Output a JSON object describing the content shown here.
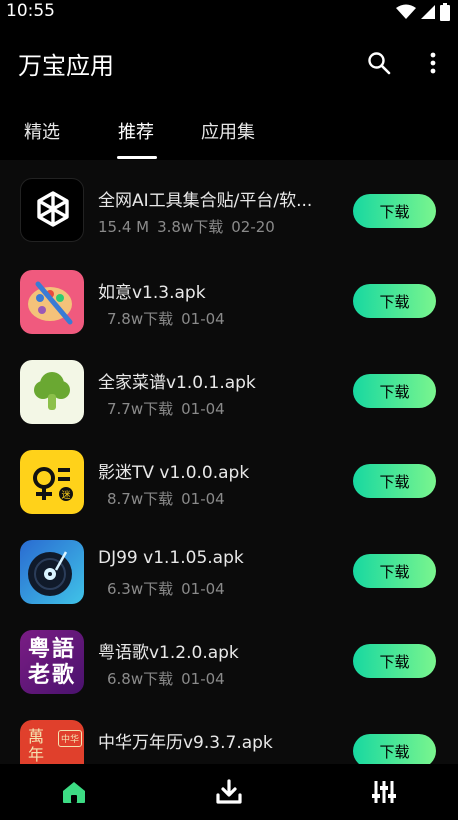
{
  "status": {
    "time": "10:55"
  },
  "header": {
    "title": "万宝应用"
  },
  "tabs": [
    {
      "label": "精选"
    },
    {
      "label": "推荐"
    },
    {
      "label": "应用集"
    }
  ],
  "active_tab": "推荐",
  "apps": [
    {
      "name": "全网AI工具集合贴/平台/软...",
      "size": "15.4 M",
      "downloads": "3.8w下载",
      "date": "02-20",
      "button": "下载",
      "icon": "openai-logo-icon"
    },
    {
      "name": "如意v1.3.apk",
      "size": "",
      "downloads": "7.8w下载",
      "date": "01-04",
      "button": "下载",
      "icon": "palette-icon"
    },
    {
      "name": "全家菜谱v1.0.1.apk",
      "size": "",
      "downloads": "7.7w下载",
      "date": "01-04",
      "button": "下载",
      "icon": "broccoli-icon"
    },
    {
      "name": "影迷TV v1.0.0.apk",
      "size": "",
      "downloads": "8.7w下载",
      "date": "01-04",
      "button": "下载",
      "icon": "yingmi-logo-icon"
    },
    {
      "name": "DJ99 v1.1.05.apk",
      "size": "",
      "downloads": "6.3w下载",
      "date": "01-04",
      "button": "下载",
      "icon": "vinyl-record-icon"
    },
    {
      "name": "粤语歌v1.2.0.apk",
      "size": "",
      "downloads": "6.8w下载",
      "date": "01-04",
      "button": "下载",
      "icon": "cantonese-song-icon"
    },
    {
      "name": "中华万年历v9.3.7.apk",
      "size": "",
      "downloads": "",
      "date": "",
      "button": "下载",
      "icon": "calendar-icon"
    }
  ],
  "icon_texts": {
    "cantonese": "粤語老歌",
    "calendar": "萬年",
    "calendar_small": "中华",
    "yingmi_small": "迷"
  },
  "colors": {
    "accent_start": "#18d8a0",
    "accent_end": "#7af58e",
    "home_active": "#3ddc84"
  },
  "bottom_nav": [
    {
      "icon": "home-icon"
    },
    {
      "icon": "download-icon"
    },
    {
      "icon": "sliders-icon"
    }
  ]
}
